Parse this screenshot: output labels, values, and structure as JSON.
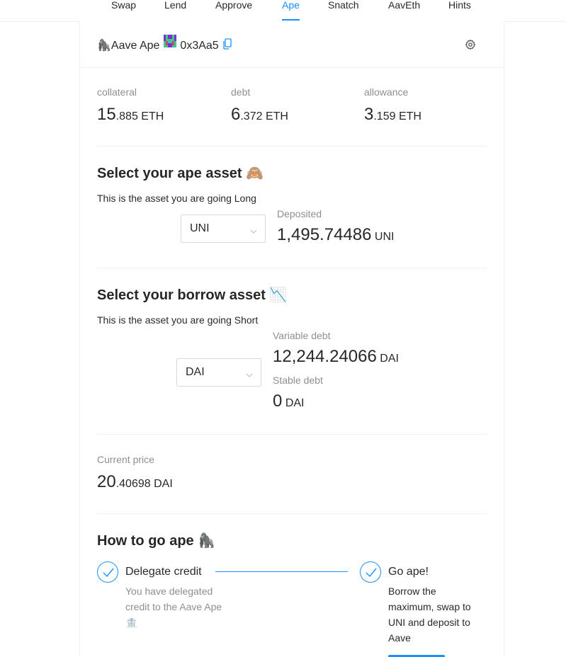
{
  "nav": {
    "items": [
      {
        "label": "Swap"
      },
      {
        "label": "Lend"
      },
      {
        "label": "Approve"
      },
      {
        "label": "Ape"
      },
      {
        "label": "Snatch"
      },
      {
        "label": "AavEth"
      },
      {
        "label": "Hints"
      }
    ],
    "active": "Ape"
  },
  "header": {
    "title_emoji": "🦍",
    "title": "Aave Ape",
    "address": "0x3Aa5"
  },
  "stats": {
    "collateral": {
      "label": "collateral",
      "int": "15",
      "dec": ".885",
      "unit": "ETH"
    },
    "debt": {
      "label": "debt",
      "int": "6",
      "dec": ".372",
      "unit": "ETH"
    },
    "allowance": {
      "label": "allowance",
      "int": "3",
      "dec": ".159",
      "unit": "ETH"
    }
  },
  "ape_asset": {
    "heading": "Select your ape asset 🙈",
    "subtext": "This is the asset you are going Long",
    "selected": "UNI",
    "deposited_label": "Deposited",
    "deposited_value": "1,495.74486",
    "deposited_unit": "UNI"
  },
  "borrow_asset": {
    "heading": "Select your borrow asset 📉",
    "subtext": "This is the asset you are going Short",
    "selected": "DAI",
    "variable_label": "Variable debt",
    "variable_value": "12,244.24066",
    "variable_unit": "DAI",
    "stable_label": "Stable debt",
    "stable_value": "0",
    "stable_unit": "DAI"
  },
  "price": {
    "label": "Current price",
    "int": "20",
    "dec": ".40698",
    "unit": "DAI"
  },
  "how_to": {
    "heading": "How to go ape 🦍",
    "steps": [
      {
        "title": "Delegate credit",
        "description": "You have delegated credit to the Aave Ape 🏦"
      },
      {
        "title": "Go ape!",
        "description": "Borrow the maximum, swap to UNI and deposit to Aave"
      }
    ]
  },
  "colors": {
    "accent": "#1890ff",
    "border": "#f0f0f0",
    "muted_text": "rgba(0,0,0,0.45)"
  }
}
